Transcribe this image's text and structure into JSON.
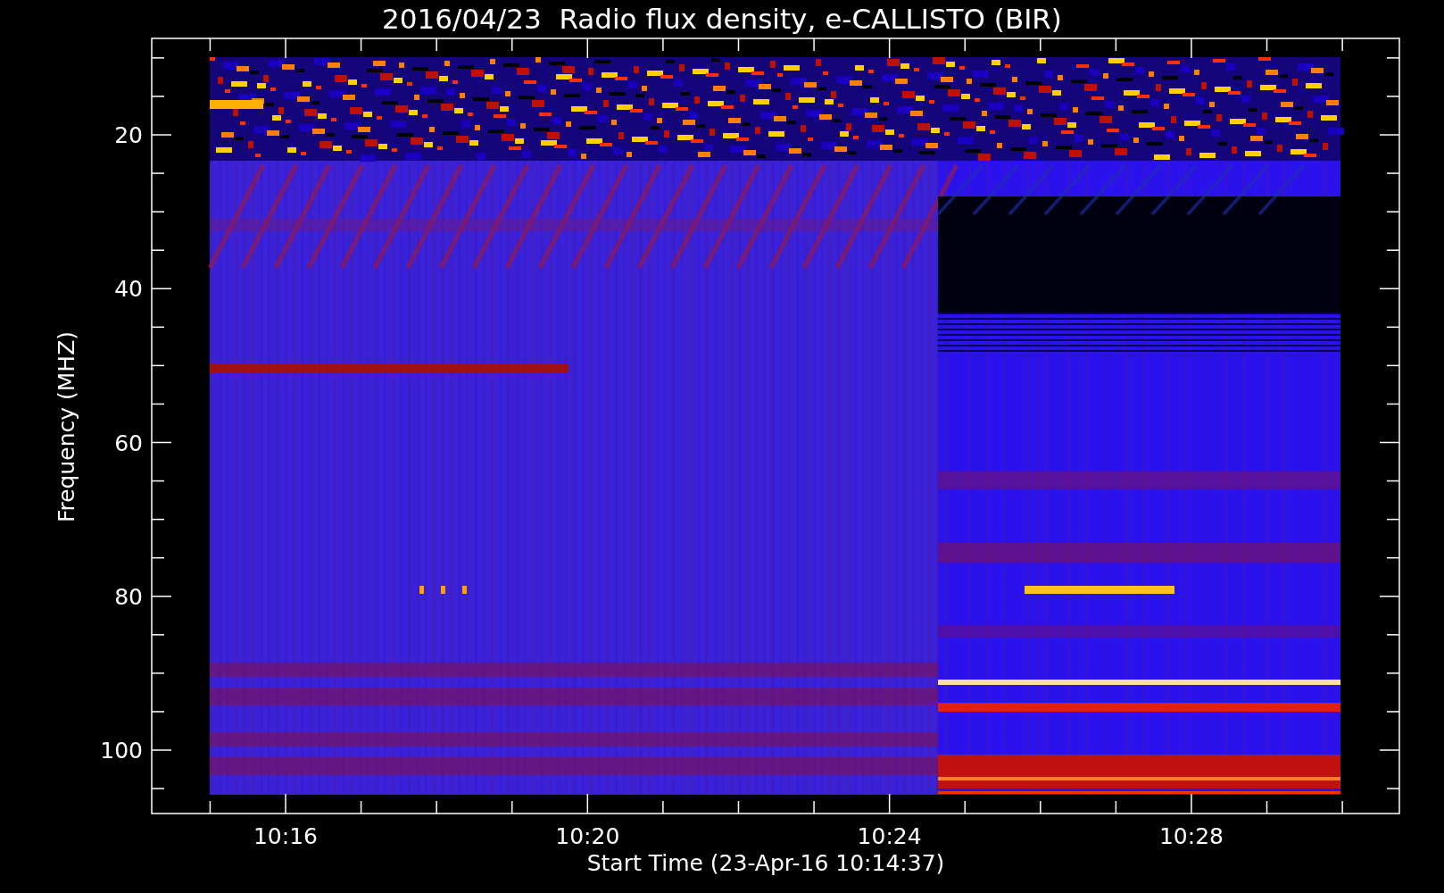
{
  "title": "2016/04/23  Radio flux density, e-CALLISTO (BIR)",
  "plot": {
    "ylabel": "Frequency (MHZ)",
    "xlabel": "Start Time (23-Apr-16 10:14:37)",
    "yticks": [
      "20",
      "40",
      "60",
      "80",
      "100"
    ],
    "xticks": [
      "10:16",
      "10:20",
      "10:24",
      "10:28"
    ]
  }
}
